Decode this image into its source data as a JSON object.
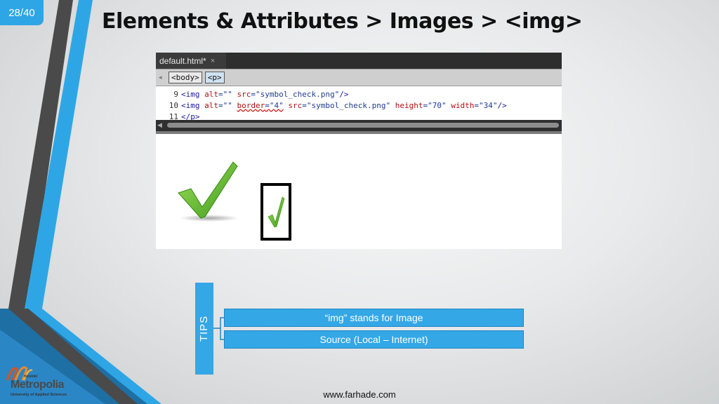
{
  "slide": {
    "number": "28/40",
    "title": "Elements & Attributes > Images > <img>"
  },
  "editor": {
    "tab_label": "default.html*",
    "tab_close": "×",
    "breadcrumbs": [
      "<body>",
      "<p>"
    ],
    "code_lines": [
      {
        "number": "9",
        "segments": [
          {
            "t": "<img ",
            "c": "tag"
          },
          {
            "t": "alt",
            "c": "attr"
          },
          {
            "t": "=\"\" ",
            "c": "val"
          },
          {
            "t": "src",
            "c": "attr"
          },
          {
            "t": "=\"symbol_check.png\"",
            "c": "val"
          },
          {
            "t": "/>",
            "c": "tag"
          }
        ]
      },
      {
        "number": "10",
        "segments": [
          {
            "t": "<img ",
            "c": "tag"
          },
          {
            "t": "alt",
            "c": "attr"
          },
          {
            "t": "=\"\" ",
            "c": "val"
          },
          {
            "t": "border",
            "c": "attr squig"
          },
          {
            "t": "=\"4\"",
            "c": "val squig"
          },
          {
            "t": " ",
            "c": "val"
          },
          {
            "t": "src",
            "c": "attr"
          },
          {
            "t": "=\"symbol_check.png\" ",
            "c": "val"
          },
          {
            "t": "height",
            "c": "attr"
          },
          {
            "t": "=\"70\" ",
            "c": "val"
          },
          {
            "t": "width",
            "c": "attr"
          },
          {
            "t": "=\"34\"",
            "c": "val"
          },
          {
            "t": "/>",
            "c": "tag"
          }
        ]
      },
      {
        "number": "11",
        "segments": [
          {
            "t": "</p>",
            "c": "tag"
          }
        ]
      }
    ]
  },
  "tips": {
    "label": "TIPS",
    "items": [
      "“img” stands for Image",
      "Source (Local – Internet)"
    ]
  },
  "footer": {
    "url": "www.farhade.com"
  },
  "logo": {
    "line1": "Helsinki",
    "main": "Metropolia",
    "line2": "University of Applied Sciences"
  },
  "colors": {
    "accent": "#34a7e6",
    "check_green": "#5cb82c"
  }
}
